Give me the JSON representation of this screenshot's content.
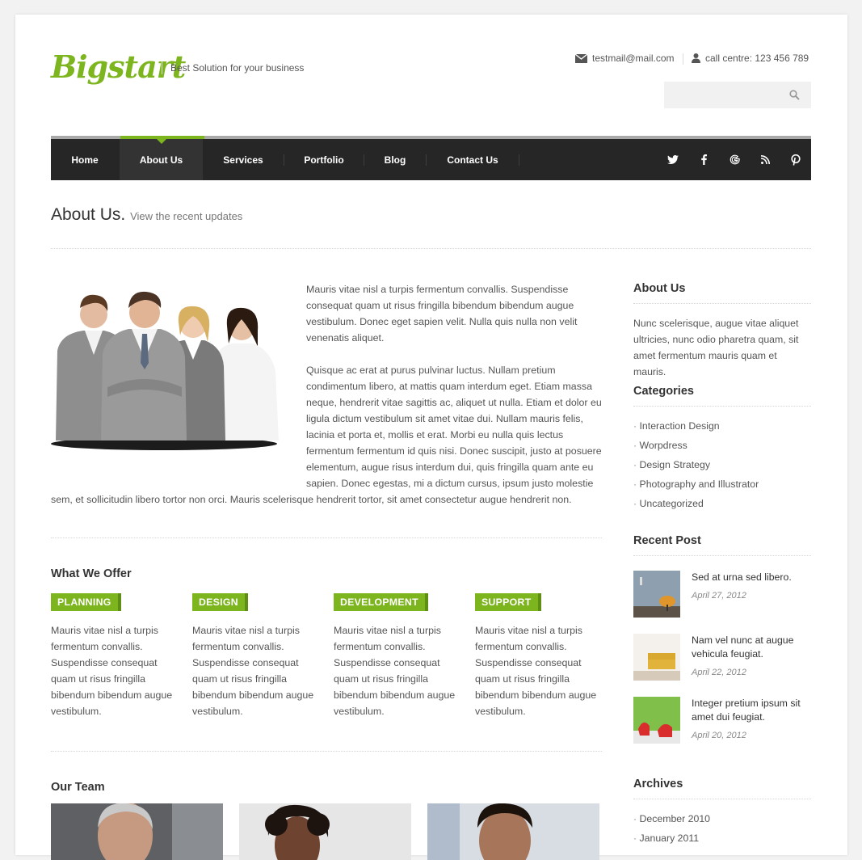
{
  "brand": {
    "logo": "Bigstart",
    "tagline": "Best Solution for your business"
  },
  "contact": {
    "email": "testmail@mail.com",
    "phone": "call centre: 123 456 789"
  },
  "search": {
    "placeholder": ""
  },
  "nav": {
    "items": [
      "Home",
      "About Us",
      "Services",
      "Portfolio",
      "Blog",
      "Contact Us"
    ],
    "active": "About Us",
    "social": [
      "twitter-icon",
      "facebook-icon",
      "google-icon",
      "rss-icon",
      "pinterest-icon"
    ]
  },
  "page_header": {
    "title": "About Us.",
    "subtitle": "View the recent updates"
  },
  "intro": {
    "p1": "Mauris vitae nisl a turpis fermentum convallis. Suspendisse consequat quam ut risus fringilla bibendum bibendum augue vestibulum. Donec eget sapien velit. Nulla quis nulla non velit venenatis aliquet.",
    "p2": "Quisque ac erat at purus pulvinar luctus. Nullam pretium condimentum libero, at mattis quam interdum eget. Etiam massa neque, hendrerit vitae sagittis ac, aliquet ut nulla. Etiam et dolor eu ligula dictum vestibulum sit amet vitae dui. Nullam mauris felis, lacinia et porta et, mollis et erat. Morbi eu nulla quis lectus fermentum fermentum id quis nisi. Donec suscipit, justo at posuere elementum, augue risus interdum dui, quis fringilla quam ante eu sapien. Donec egestas, mi a dictum cursus, ipsum justo molestie sem, et sollicitudin libero tortor non orci. Mauris scelerisque hendrerit tortor, sit amet consectetur augue hendrerit non."
  },
  "offer": {
    "title": "What We Offer",
    "items": [
      {
        "label": "PLANNING",
        "text": "Mauris vitae nisl a turpis fermentum convallis. Suspendisse consequat quam ut risus fringilla bibendum bibendum augue vestibulum."
      },
      {
        "label": "DESIGN",
        "text": "Mauris vitae nisl a turpis fermentum convallis. Suspendisse consequat quam ut risus fringilla bibendum bibendum augue vestibulum."
      },
      {
        "label": "DEVELOPMENT",
        "text": "Mauris vitae nisl a turpis fermentum convallis. Suspendisse consequat quam ut risus fringilla bibendum bibendum augue vestibulum."
      },
      {
        "label": "SUPPORT",
        "text": "Mauris vitae nisl a turpis fermentum convallis. Suspendisse consequat quam ut risus fringilla bibendum bibendum augue vestibulum."
      }
    ]
  },
  "team": {
    "title": "Our Team"
  },
  "sidebar": {
    "about": {
      "title": "About Us",
      "text": "Nunc scelerisque, augue vitae aliquet ultricies, nunc odio pharetra quam, sit amet fermentum mauris quam et mauris."
    },
    "categories": {
      "title": "Categories",
      "items": [
        "Interaction Design",
        "Worpdress",
        "Design Strategy",
        "Photography and Illustrator",
        "Uncategorized"
      ]
    },
    "recent": {
      "title": "Recent Post",
      "items": [
        {
          "title": "Sed at urna sed libero.",
          "date": "April 27, 2012"
        },
        {
          "title": "Nam vel nunc at augue vehicula feugiat.",
          "date": "April 22, 2012"
        },
        {
          "title": "Integer pretium ipsum sit amet dui feugiat.",
          "date": "April 20, 2012"
        }
      ]
    },
    "archives": {
      "title": "Archives",
      "items": [
        "December 2010",
        "January 2011"
      ]
    }
  },
  "colors": {
    "accent": "#7cb51e",
    "nav_bg": "#262626"
  }
}
